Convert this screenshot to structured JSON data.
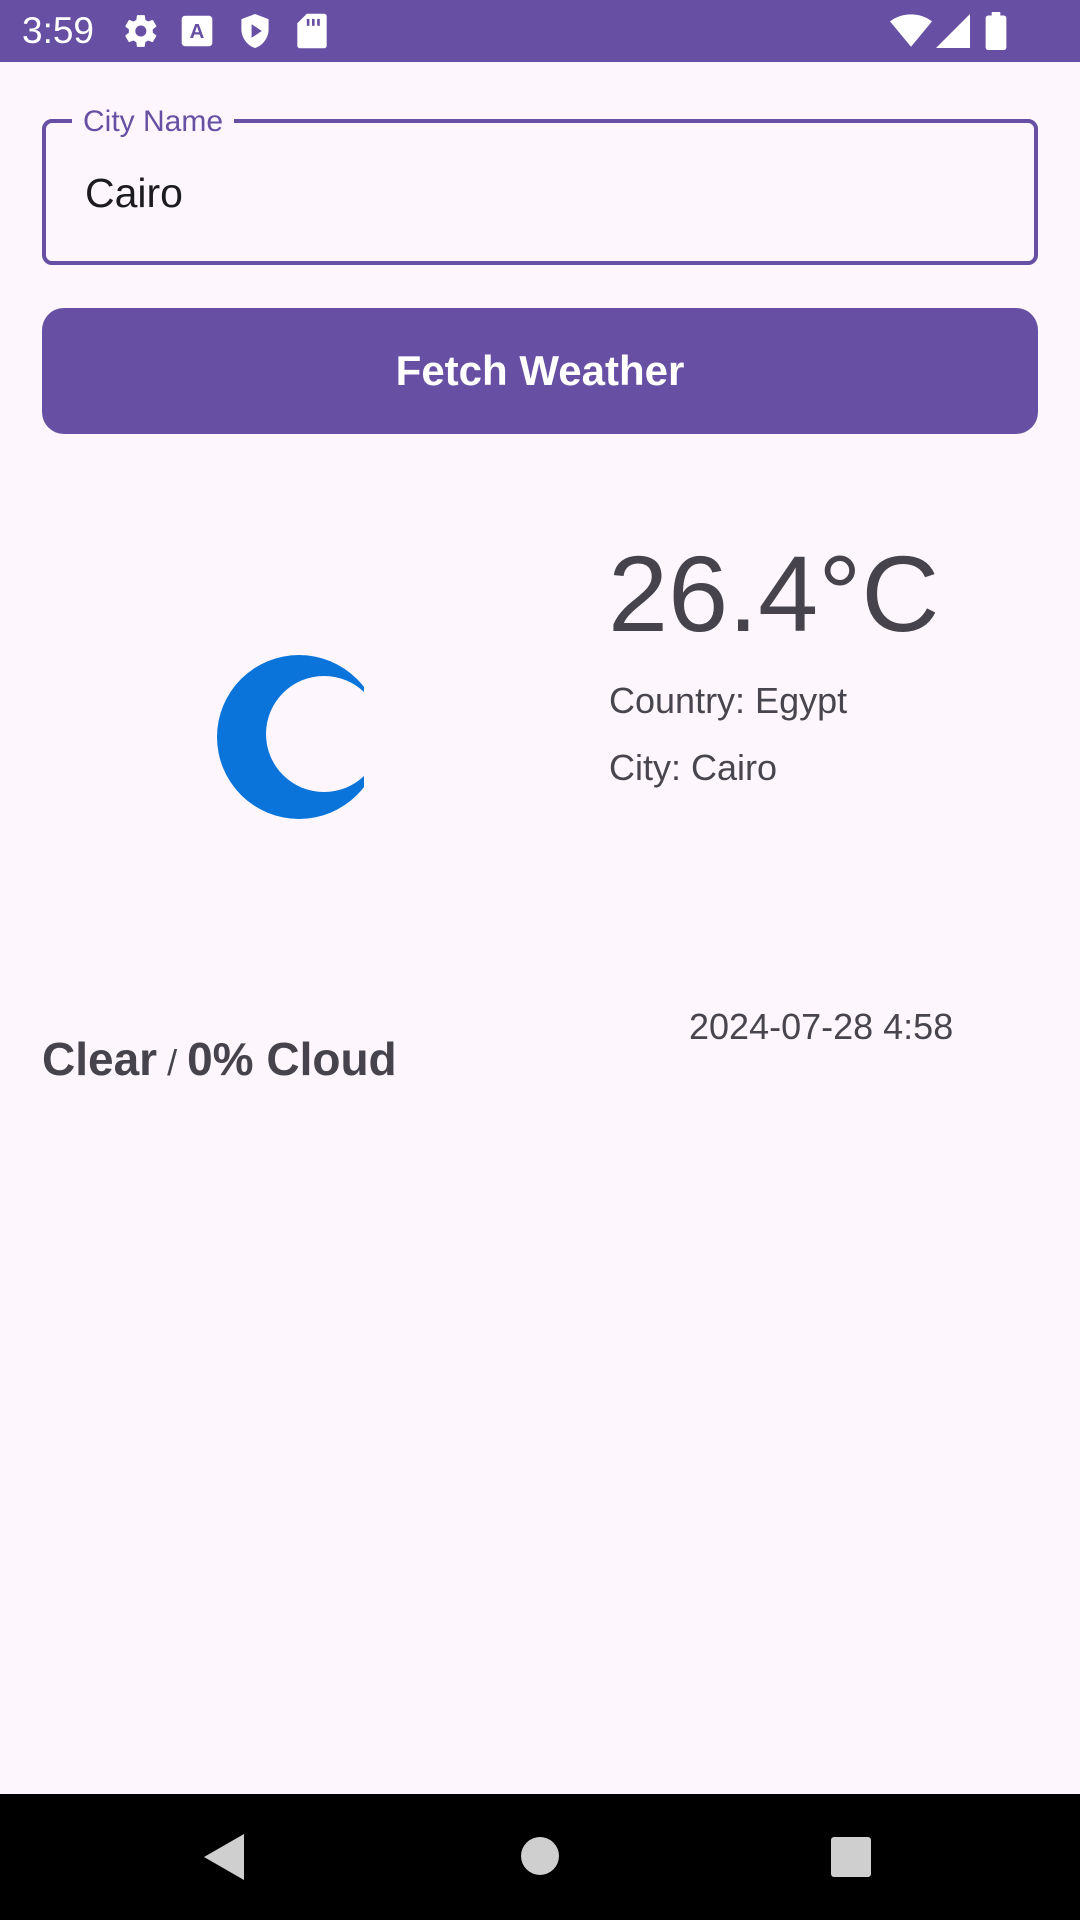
{
  "status_bar": {
    "time": "3:59",
    "left_icons": [
      "settings-icon",
      "font-icon",
      "play-protect-icon",
      "sd-card-icon"
    ],
    "right_icons": [
      "wifi-icon",
      "signal-icon",
      "battery-icon"
    ]
  },
  "city_input": {
    "label": "City Name",
    "value": "Cairo"
  },
  "fetch_button": {
    "label": "Fetch Weather"
  },
  "weather": {
    "icon": "crescent-moon-icon",
    "temperature": "26.4°C",
    "country": "Country: Egypt",
    "city": "City: Cairo",
    "condition": "Clear",
    "separator": "/",
    "cloud": "0% Cloud",
    "datetime": "2024-07-28 4:58"
  },
  "nav_bar": {
    "buttons": [
      "back-icon",
      "home-icon",
      "recents-icon"
    ]
  },
  "colors": {
    "primary": "#6750A4",
    "background": "#FDF7FD",
    "icon_blue": "#0A74DA"
  }
}
